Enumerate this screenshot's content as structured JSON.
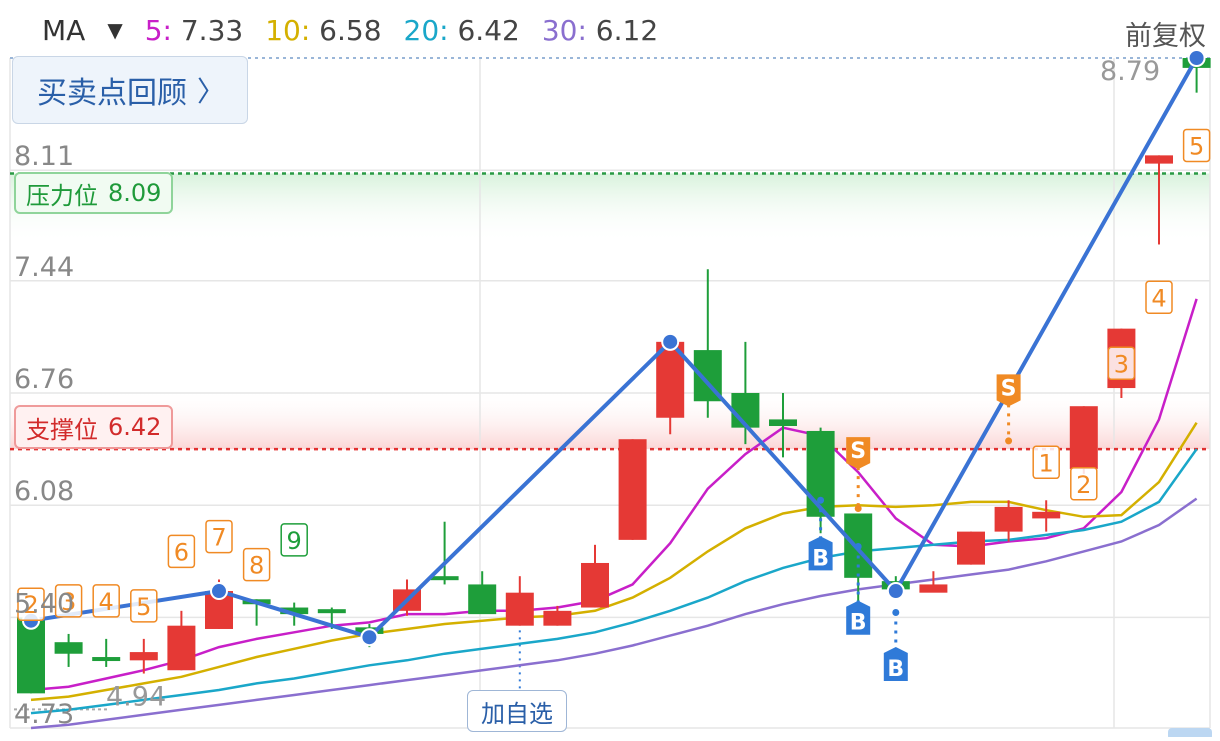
{
  "indicator": {
    "selector_label": "MA",
    "items": [
      {
        "key": "5:",
        "value": "7.33",
        "color": "#c81fc8"
      },
      {
        "key": "10:",
        "value": "6.58",
        "color": "#d4b000"
      },
      {
        "key": "20:",
        "value": "6.42",
        "color": "#1aa7c9"
      },
      {
        "key": "30:",
        "value": "6.12",
        "color": "#8a6fcf"
      }
    ]
  },
  "buttons": {
    "review_label": "买卖点回顾",
    "fuquan_label": "前复权",
    "add_watch_label": "加自选"
  },
  "levels": {
    "pressure_label": "压力位",
    "pressure_value": "8.09",
    "support_label": "支撑位",
    "support_value": "6.42"
  },
  "chart_data": {
    "type": "candlestick",
    "y_ticks": [
      "8.11",
      "7.44",
      "6.76",
      "6.08",
      "5.40",
      "4.73"
    ],
    "ylim": [
      4.73,
      8.79
    ],
    "price_labels": {
      "high": "8.79",
      "low": "4.94"
    },
    "up_color": "#e53935",
    "down_color": "#1e9e3a",
    "candles": [
      {
        "o": 5.4,
        "c": 4.94,
        "h": 5.4,
        "l": 4.94
      },
      {
        "o": 5.25,
        "c": 5.18,
        "h": 5.3,
        "l": 5.1
      },
      {
        "o": 5.16,
        "c": 5.15,
        "h": 5.27,
        "l": 5.1
      },
      {
        "o": 5.14,
        "c": 5.19,
        "h": 5.27,
        "l": 5.06
      },
      {
        "o": 5.08,
        "c": 5.35,
        "h": 5.44,
        "l": 5.08
      },
      {
        "o": 5.33,
        "c": 5.56,
        "h": 5.63,
        "l": 5.33
      },
      {
        "o": 5.51,
        "c": 5.48,
        "h": 5.51,
        "l": 5.35
      },
      {
        "o": 5.46,
        "c": 5.42,
        "h": 5.49,
        "l": 5.35
      },
      {
        "o": 5.45,
        "c": 5.43,
        "h": 5.46,
        "l": 5.33
      },
      {
        "o": 5.34,
        "c": 5.3,
        "h": 5.36,
        "l": 5.22
      },
      {
        "o": 5.44,
        "c": 5.57,
        "h": 5.63,
        "l": 5.41
      },
      {
        "o": 5.65,
        "c": 5.64,
        "h": 5.98,
        "l": 5.6
      },
      {
        "o": 5.6,
        "c": 5.42,
        "h": 5.68,
        "l": 5.43
      },
      {
        "o": 5.35,
        "c": 5.55,
        "h": 5.65,
        "l": 5.35
      },
      {
        "o": 5.35,
        "c": 5.44,
        "h": 5.47,
        "l": 5.35
      },
      {
        "o": 5.46,
        "c": 5.73,
        "h": 5.84,
        "l": 5.46
      },
      {
        "o": 5.87,
        "c": 6.48,
        "h": 6.48,
        "l": 5.87
      },
      {
        "o": 6.61,
        "c": 7.07,
        "h": 7.07,
        "l": 6.51
      },
      {
        "o": 7.02,
        "c": 6.71,
        "h": 7.51,
        "l": 6.61
      },
      {
        "o": 6.76,
        "c": 6.55,
        "h": 7.07,
        "l": 6.45
      },
      {
        "o": 6.6,
        "c": 6.56,
        "h": 6.76,
        "l": 6.37
      },
      {
        "o": 6.53,
        "c": 6.01,
        "h": 6.55,
        "l": 5.91
      },
      {
        "o": 6.03,
        "c": 5.64,
        "h": 6.03,
        "l": 5.44
      },
      {
        "o": 5.62,
        "c": 5.57,
        "h": 5.65,
        "l": 5.53
      },
      {
        "o": 5.55,
        "c": 5.6,
        "h": 5.68,
        "l": 5.57
      },
      {
        "o": 5.72,
        "c": 5.92,
        "h": 5.92,
        "l": 5.72
      },
      {
        "o": 5.92,
        "c": 6.07,
        "h": 6.11,
        "l": 5.86
      },
      {
        "o": 6.0,
        "c": 6.04,
        "h": 6.11,
        "l": 5.92
      },
      {
        "o": 6.3,
        "c": 6.68,
        "h": 6.68,
        "l": 6.27
      },
      {
        "o": 6.79,
        "c": 7.15,
        "h": 7.15,
        "l": 6.73
      },
      {
        "o": 8.15,
        "c": 8.2,
        "h": 8.2,
        "l": 7.66
      },
      {
        "o": 8.79,
        "c": 8.73,
        "h": 8.79,
        "l": 8.58
      }
    ],
    "ma_lines": [
      {
        "name": "5",
        "color": "#c81fc8",
        "values": [
          4.96,
          4.98,
          5.03,
          5.08,
          5.14,
          5.22,
          5.27,
          5.31,
          5.35,
          5.37,
          5.42,
          5.42,
          5.44,
          5.44,
          5.46,
          5.5,
          5.6,
          5.85,
          6.18,
          6.39,
          6.55,
          6.5,
          6.28,
          6.0,
          5.84,
          5.83,
          5.86,
          5.88,
          5.94,
          6.16,
          6.6,
          7.33
        ]
      },
      {
        "name": "10",
        "color": "#d4b000",
        "values": [
          4.9,
          4.92,
          4.96,
          5.0,
          5.04,
          5.1,
          5.16,
          5.21,
          5.26,
          5.3,
          5.33,
          5.36,
          5.38,
          5.4,
          5.41,
          5.44,
          5.52,
          5.64,
          5.8,
          5.94,
          6.03,
          6.07,
          6.08,
          6.07,
          6.08,
          6.1,
          6.1,
          6.05,
          6.01,
          6.02,
          6.22,
          6.58
        ]
      },
      {
        "name": "20",
        "color": "#1aa7c9",
        "values": [
          4.82,
          4.84,
          4.87,
          4.9,
          4.93,
          4.96,
          5.0,
          5.03,
          5.07,
          5.11,
          5.14,
          5.18,
          5.21,
          5.24,
          5.27,
          5.31,
          5.37,
          5.44,
          5.52,
          5.62,
          5.7,
          5.76,
          5.8,
          5.82,
          5.84,
          5.86,
          5.87,
          5.9,
          5.93,
          5.98,
          6.1,
          6.42
        ]
      },
      {
        "name": "30",
        "color": "#8a6fcf",
        "values": [
          4.73,
          4.75,
          4.78,
          4.81,
          4.84,
          4.87,
          4.9,
          4.93,
          4.96,
          4.99,
          5.02,
          5.05,
          5.08,
          5.11,
          5.14,
          5.18,
          5.23,
          5.29,
          5.35,
          5.42,
          5.48,
          5.53,
          5.57,
          5.6,
          5.63,
          5.66,
          5.69,
          5.74,
          5.8,
          5.86,
          5.96,
          6.12
        ]
      }
    ],
    "zigzag": [
      {
        "i": 0,
        "v": 5.38
      },
      {
        "i": 5,
        "v": 5.56
      },
      {
        "i": 9,
        "v": 5.28
      },
      {
        "i": 17,
        "v": 7.07
      },
      {
        "i": 23,
        "v": 5.56
      },
      {
        "i": 31,
        "v": 8.79
      }
    ],
    "count_labels": [
      {
        "i": 0,
        "text": "2",
        "color": "#f08a24",
        "v": 5.48
      },
      {
        "i": 1,
        "text": "3",
        "color": "#f08a24",
        "v": 5.5
      },
      {
        "i": 2,
        "text": "4",
        "color": "#f08a24",
        "v": 5.5
      },
      {
        "i": 3,
        "text": "5",
        "color": "#f08a24",
        "v": 5.47
      },
      {
        "i": 4,
        "text": "6",
        "color": "#f08a24",
        "v": 5.8
      },
      {
        "i": 5,
        "text": "7",
        "color": "#f08a24",
        "v": 5.89
      },
      {
        "i": 6,
        "text": "8",
        "color": "#f08a24",
        "v": 5.72
      },
      {
        "i": 7,
        "text": "9",
        "color": "#1e9e3a",
        "v": 5.87
      },
      {
        "i": 27,
        "text": "1",
        "color": "#f08a24",
        "v": 6.34
      },
      {
        "i": 28,
        "text": "2",
        "color": "#f08a24",
        "v": 6.21
      },
      {
        "i": 29,
        "text": "3",
        "color": "#f08a24",
        "v": 6.94
      },
      {
        "i": 30,
        "text": "4",
        "color": "#f08a24",
        "v": 7.34
      },
      {
        "i": 31,
        "text": "5",
        "color": "#f08a24",
        "v": 8.26
      }
    ],
    "signals": [
      {
        "i": 21,
        "type": "B",
        "color": "#2f7ad8",
        "v": 5.77,
        "stem_to": 6.11
      },
      {
        "i": 22,
        "type": "B",
        "color": "#2f7ad8",
        "v": 5.38,
        "stem_to": 5.83
      },
      {
        "i": 23,
        "type": "B",
        "color": "#2f7ad8",
        "v": 5.1,
        "stem_to": 5.43
      },
      {
        "i": 22,
        "type": "S",
        "color": "#f08a24",
        "v": 6.42,
        "stem_to": 6.06
      },
      {
        "i": 26,
        "type": "S",
        "color": "#f08a24",
        "v": 6.8,
        "stem_to": 6.47
      }
    ]
  }
}
